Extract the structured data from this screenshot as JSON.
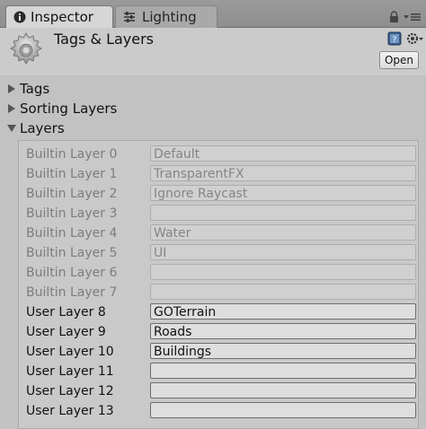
{
  "tabs": [
    {
      "label": "Inspector",
      "icon": "info-icon",
      "active": true
    },
    {
      "label": "Lighting",
      "icon": "sliders-icon",
      "active": false
    }
  ],
  "header": {
    "title": "Tags & Layers",
    "open_label": "Open",
    "icon": "gear-icon"
  },
  "sections": {
    "tags": "Tags",
    "sorting_layers": "Sorting Layers",
    "layers": "Layers"
  },
  "layers": [
    {
      "name": "Builtin Layer 0",
      "value": "Default",
      "builtin": true
    },
    {
      "name": "Builtin Layer 1",
      "value": "TransparentFX",
      "builtin": true
    },
    {
      "name": "Builtin Layer 2",
      "value": "Ignore Raycast",
      "builtin": true
    },
    {
      "name": "Builtin Layer 3",
      "value": "",
      "builtin": true
    },
    {
      "name": "Builtin Layer 4",
      "value": "Water",
      "builtin": true
    },
    {
      "name": "Builtin Layer 5",
      "value": "UI",
      "builtin": true
    },
    {
      "name": "Builtin Layer 6",
      "value": "",
      "builtin": true
    },
    {
      "name": "Builtin Layer 7",
      "value": "",
      "builtin": true
    },
    {
      "name": "User Layer 8",
      "value": "GOTerrain",
      "builtin": false
    },
    {
      "name": "User Layer 9",
      "value": "Roads",
      "builtin": false
    },
    {
      "name": "User Layer 10",
      "value": "Buildings",
      "builtin": false
    },
    {
      "name": "User Layer 11",
      "value": "",
      "builtin": false
    },
    {
      "name": "User Layer 12",
      "value": "",
      "builtin": false
    },
    {
      "name": "User Layer 13",
      "value": "",
      "builtin": false
    }
  ]
}
